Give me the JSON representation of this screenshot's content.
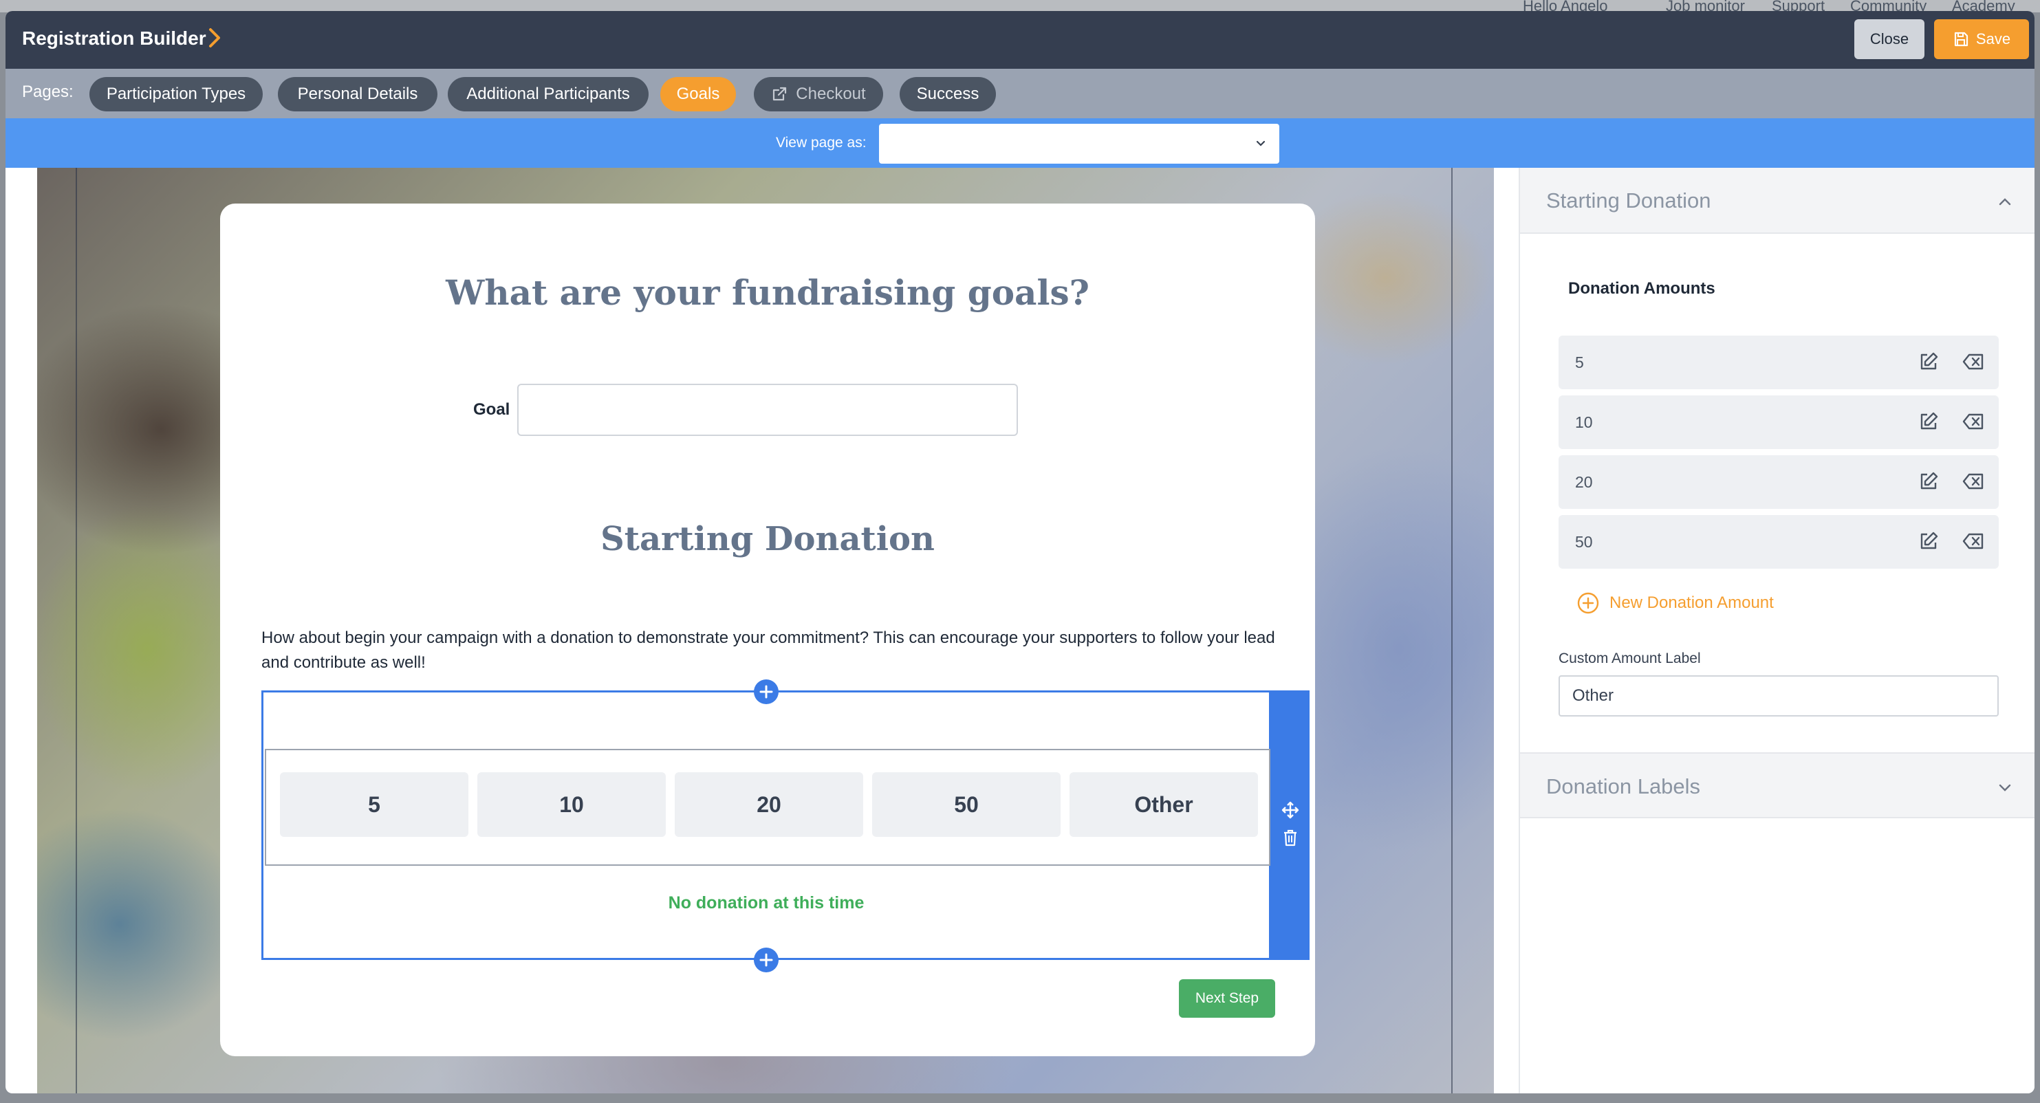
{
  "background_nav": {
    "items": [
      "Hello Angelo",
      "Job monitor",
      "Support",
      "Community",
      "Academy"
    ]
  },
  "header": {
    "title": "Registration Builder",
    "close_label": "Close",
    "save_label": "Save"
  },
  "pages_bar": {
    "label": "Pages:",
    "tabs": [
      {
        "label": "Participation Types"
      },
      {
        "label": "Personal Details"
      },
      {
        "label": "Additional Participants"
      },
      {
        "label": "Goals",
        "active": true
      },
      {
        "label": "Checkout",
        "external_link": true
      },
      {
        "label": "Success"
      }
    ]
  },
  "view_bar": {
    "label": "View page as:",
    "selected": ""
  },
  "form": {
    "heading": "What are your fundraising goals?",
    "goal_label": "Goal",
    "goal_value": "",
    "section_heading": "Starting Donation",
    "description": "How about begin your campaign with a donation to demonstrate your commitment? This can encourage your supporters to follow your lead and contribute as well!",
    "amounts": [
      "5",
      "10",
      "20",
      "50",
      "Other"
    ],
    "no_donation_label": "No donation at this time",
    "next_label": "Next Step"
  },
  "panel": {
    "section_title": "Starting Donation",
    "amounts_label": "Donation Amounts",
    "amounts": [
      "5",
      "10",
      "20",
      "50"
    ],
    "new_amount_label": "New Donation Amount",
    "custom_label_title": "Custom Amount Label",
    "custom_label_value": "Other",
    "labels_section_title": "Donation Labels"
  },
  "colors": {
    "header_bg": "#353e50",
    "accent_orange": "#f59e2f",
    "accent_blue": "#3b7be6",
    "success_green": "#3fae5a"
  }
}
